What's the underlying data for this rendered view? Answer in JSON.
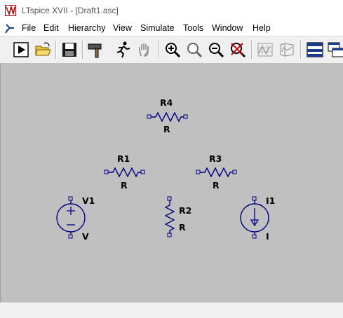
{
  "window": {
    "title": "LTspice XVII - [Draft1.asc]"
  },
  "menu": {
    "items": [
      "File",
      "Edit",
      "Hierarchy",
      "View",
      "Simulate",
      "Tools",
      "Window",
      "Help"
    ]
  },
  "toolbar": {
    "buttons": [
      "run",
      "open",
      "save",
      "hammer",
      "runner",
      "hand",
      "zoom-in",
      "zoom-fit",
      "zoom-out",
      "zoom-cancel",
      "waveform-1",
      "waveform-2",
      "window-1",
      "window-2"
    ]
  },
  "schematic": {
    "components": [
      {
        "ref": "R4",
        "value": "R"
      },
      {
        "ref": "R1",
        "value": "R"
      },
      {
        "ref": "R3",
        "value": "R"
      },
      {
        "ref": "R2",
        "value": "R"
      },
      {
        "ref": "V1",
        "value": "V"
      },
      {
        "ref": "I1",
        "value": "I"
      }
    ],
    "wire_color": "#000080",
    "pin_color": "#000080"
  }
}
